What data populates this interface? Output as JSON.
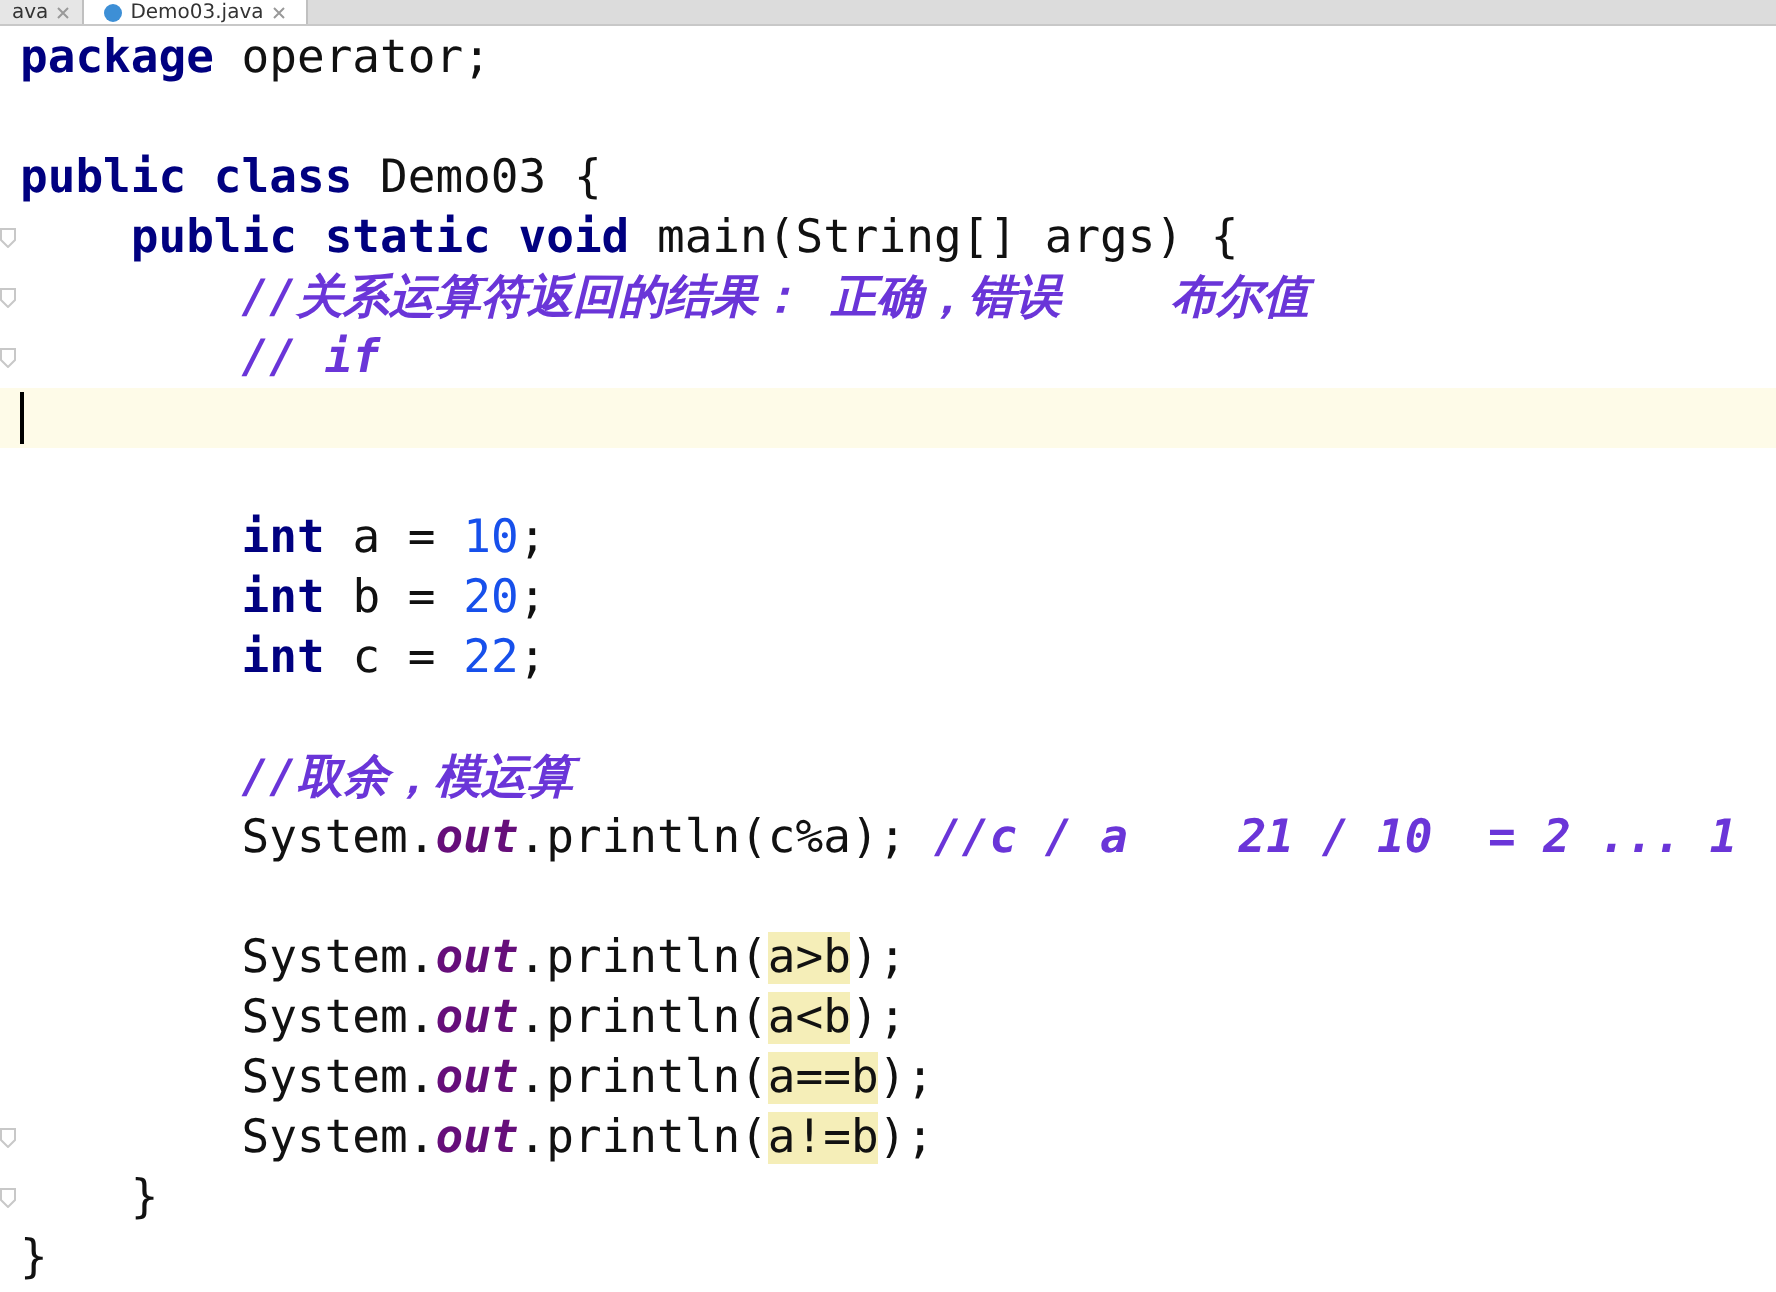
{
  "tabs": [
    {
      "label": "ava",
      "selected": false,
      "icon": false
    },
    {
      "label": "Demo03.java",
      "selected": true,
      "icon": true
    }
  ],
  "lines": [
    {
      "kind": "code",
      "tokens": [
        {
          "kind": "keyword",
          "text": "package"
        },
        {
          "kind": "plain",
          "text": " operator;"
        }
      ]
    },
    {
      "kind": "blank"
    },
    {
      "kind": "code",
      "tokens": [
        {
          "kind": "keyword",
          "text": "public class"
        },
        {
          "kind": "plain",
          "text": " Demo03 {"
        }
      ],
      "children": [
        {
          "kind": "code",
          "fold": true,
          "tokens": [
            {
              "kind": "keyword",
              "text": "public static void"
            },
            {
              "kind": "plain",
              "text": " main(String[] args) {"
            }
          ],
          "children": [
            {
              "kind": "code",
              "fold": true,
              "tokens": [
                {
                  "kind": "comment",
                  "text": "//关系运算符返回的结果： 正确，错误    布尔值"
                }
              ]
            },
            {
              "kind": "code",
              "fold": true,
              "tokens": [
                {
                  "kind": "comment",
                  "text": "// if"
                }
              ]
            },
            {
              "kind": "blank",
              "current": true
            },
            {
              "kind": "blank"
            },
            {
              "kind": "code",
              "tokens": [
                {
                  "kind": "keyword",
                  "text": "int"
                },
                {
                  "kind": "plain",
                  "text": " a = "
                },
                {
                  "kind": "number",
                  "text": "10"
                },
                {
                  "kind": "plain",
                  "text": ";"
                }
              ]
            },
            {
              "kind": "code",
              "tokens": [
                {
                  "kind": "keyword",
                  "text": "int"
                },
                {
                  "kind": "plain",
                  "text": " b = "
                },
                {
                  "kind": "number",
                  "text": "20"
                },
                {
                  "kind": "plain",
                  "text": ";"
                }
              ]
            },
            {
              "kind": "code",
              "tokens": [
                {
                  "kind": "keyword",
                  "text": "int"
                },
                {
                  "kind": "plain",
                  "text": " c = "
                },
                {
                  "kind": "number",
                  "text": "22"
                },
                {
                  "kind": "plain",
                  "text": ";"
                }
              ]
            },
            {
              "kind": "blank"
            },
            {
              "kind": "code",
              "tokens": [
                {
                  "kind": "comment",
                  "text": "//取余，模运算"
                }
              ]
            },
            {
              "kind": "code",
              "tokens": [
                {
                  "kind": "plain",
                  "text": "System."
                },
                {
                  "kind": "field",
                  "text": "out"
                },
                {
                  "kind": "plain",
                  "text": ".println(c%a); "
                },
                {
                  "kind": "comment",
                  "text": "//c / a    21 / 10  = 2 ... 1"
                }
              ]
            },
            {
              "kind": "blank"
            },
            {
              "kind": "code",
              "tokens": [
                {
                  "kind": "plain",
                  "text": "System."
                },
                {
                  "kind": "field",
                  "text": "out"
                },
                {
                  "kind": "plain",
                  "text": ".println("
                },
                {
                  "kind": "match",
                  "text": "a>b"
                },
                {
                  "kind": "plain",
                  "text": ");"
                }
              ]
            },
            {
              "kind": "code",
              "tokens": [
                {
                  "kind": "plain",
                  "text": "System."
                },
                {
                  "kind": "field",
                  "text": "out"
                },
                {
                  "kind": "plain",
                  "text": ".println("
                },
                {
                  "kind": "match",
                  "text": "a<b"
                },
                {
                  "kind": "plain",
                  "text": ");"
                }
              ]
            },
            {
              "kind": "code",
              "tokens": [
                {
                  "kind": "plain",
                  "text": "System."
                },
                {
                  "kind": "field",
                  "text": "out"
                },
                {
                  "kind": "plain",
                  "text": ".println("
                },
                {
                  "kind": "match",
                  "text": "a==b"
                },
                {
                  "kind": "plain",
                  "text": ");"
                }
              ]
            },
            {
              "kind": "code",
              "fold": true,
              "tokens": [
                {
                  "kind": "plain",
                  "text": "System."
                },
                {
                  "kind": "field",
                  "text": "out"
                },
                {
                  "kind": "plain",
                  "text": ".println("
                },
                {
                  "kind": "match",
                  "text": "a!=b"
                },
                {
                  "kind": "plain",
                  "text": ");"
                }
              ]
            }
          ]
        },
        {
          "kind": "code",
          "fold": true,
          "tokens": [
            {
              "kind": "plain",
              "text": "}"
            }
          ]
        }
      ]
    },
    {
      "kind": "code",
      "tokens": [
        {
          "kind": "plain",
          "text": "}"
        }
      ]
    }
  ]
}
